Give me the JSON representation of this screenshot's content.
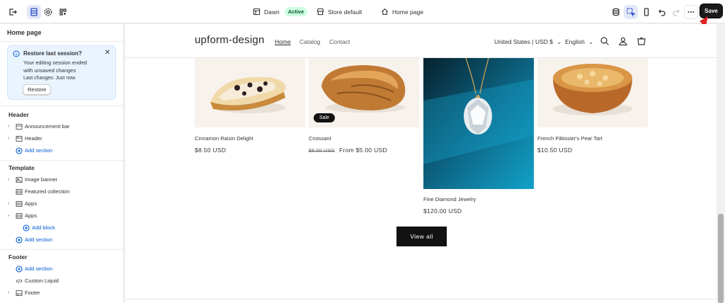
{
  "topbar": {
    "theme_name": "Dawn",
    "theme_status": "Active",
    "store_default": "Store default",
    "page": "Home page",
    "save_label": "Save"
  },
  "sidebar": {
    "title": "Home page",
    "banner": {
      "title": "Restore last session?",
      "body_line1": "Your editing session ended",
      "body_line2": "with unsaved changes",
      "last_changes": "Last changes: Just now",
      "restore_label": "Restore"
    },
    "header_section": {
      "heading": "Header",
      "items": [
        "Announcement bar",
        "Header"
      ],
      "add_section": "Add section"
    },
    "template_section": {
      "heading": "Template",
      "items": [
        "Image banner",
        "Featured collection",
        "Apps",
        "Apps"
      ],
      "add_block": "Add block",
      "add_section": "Add section"
    },
    "footer_section": {
      "heading": "Footer",
      "add_section": "Add section",
      "items": [
        "Custom Liquid",
        "Footer"
      ]
    }
  },
  "store": {
    "logo": "upform-design",
    "nav": [
      "Home",
      "Catalog",
      "Contact"
    ],
    "currency": "United States | USD $",
    "language": "English",
    "products": [
      {
        "title": "Cinnamon Raisin Delight",
        "price": "$8.50 USD"
      },
      {
        "title": "Croissant",
        "old_price": "$6.00 USD",
        "price": "From $5.00 USD",
        "badge": "Sale"
      },
      {
        "title": "Fine Diamond Jewelry",
        "price": "$120.00 USD"
      },
      {
        "title": "French Pâtissier's Pear Tart",
        "price": "$10.50 USD"
      }
    ],
    "view_all": "View all"
  },
  "colors": {
    "accent_blue": "#005bd3",
    "active_badge_bg": "#cdfee1",
    "dark_button": "#121212",
    "annotation_arrow": "#e32222"
  }
}
